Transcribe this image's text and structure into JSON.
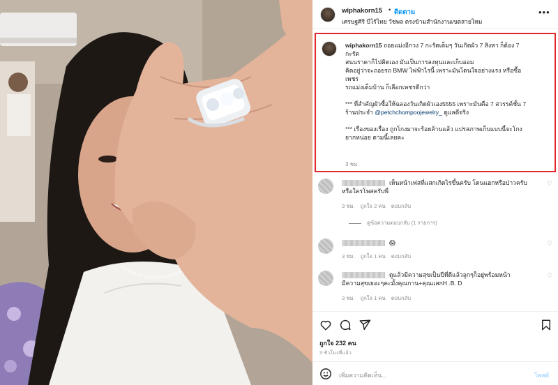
{
  "post": {
    "username": "wiphakorn15",
    "separator": "•",
    "follow_label": "ติดตาม",
    "location": "เศรษฐศิริ บีไร้ไทย วัชพล ตรงข้ามสำนักงานเขตสายไหม",
    "more_icon": "more-horizontal-icon"
  },
  "caption": {
    "username": "wiphakorn15",
    "line1": "ถอยแม่งอีกวง 7 กะรัตเต็มๆ วันเกิดผัว 7 สิงหา ก็ต้อง 7",
    "line2": "กะรัต",
    "line3": "สนนราคาก็ไปคิดเอง มันเป็นการลงทุนและเก็บออม",
    "line4": "คิดอยู่ว่าจะถอยรถ BMW ไฟฟ้าไรนี้ เพราะมันโดนใจอย่างแรง หรือซื้อ",
    "line5": "เพชร",
    "line6": "รถแม่งเด็มบ้าน ก็เลือกเพชรดีกว่า",
    "line7": "*** ที่สำคัญผัวซื้อให้ฉลองวันเกิดผัวเอง5555 เพราะมันคือ 7 สวรรค์ชั้น 7",
    "line8_prefix": "ร้านประจำ ",
    "line8_mention": "@petchchompoojewelry_",
    "line8_suffix": " ดูแลดีจริง",
    "line9": "*** เรื่องของเรื่อง ถูกโกงมาจะร้อยล้านแล้ว แปรสภาพเก็บแบบนี้จะโกง",
    "line10": "ยากหน่อย ตามนี้เลยคะ",
    "time": "3 ชม."
  },
  "comments": [
    {
      "text": "เห็นหน้าเฟสที่แสกเกิดไรขึ้นครับ โดนแฮกหรือป่าวครับ\nหรือใครโพสครับพี่",
      "time": "3 ชม.",
      "likes": "ถูกใจ 2 คน",
      "reply": "ตอบกลับ",
      "view_replies": "ดูข้อความตอบกลับ (1 รายการ)"
    },
    {
      "text": "😱",
      "time": "3 ชม.",
      "likes": "ถูกใจ 1 คน",
      "reply": "ตอบกลับ"
    },
    {
      "text": "ดูแล้วมีความสุขเป็นปีที่ดีแล้วลูกๆก็อยู่พร้อมหน้า\nมีความสุขเยอะๆคะมั้งคุณกาน+คุณแสกH .B. D",
      "time": "3 ชม.",
      "likes": "ถูกใจ 1 คน",
      "reply": "ตอบกลับ"
    }
  ],
  "actions": {
    "icons": [
      "heart-icon",
      "comment-icon",
      "share-icon",
      "bookmark-icon"
    ],
    "likes_text": "ถูกใจ 232 คน",
    "posted_time": "3 ชั่วโมงที่แล้ว"
  },
  "compose": {
    "placeholder": "เพิ่มความคิดเห็น...",
    "post_label": "โพสต์"
  },
  "colors": {
    "accent": "#0095f6",
    "highlight_border": "#e0272c",
    "muted_text": "#8e8e8e"
  }
}
